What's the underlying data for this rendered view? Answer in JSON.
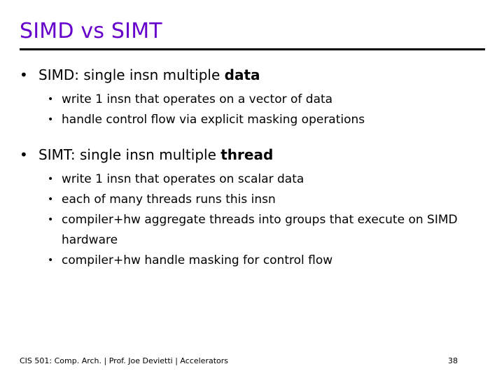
{
  "slide": {
    "title": "SIMD vs SIMT",
    "accent_color": "#6600cc",
    "rule_color": "#000000",
    "body_color": "#000000",
    "background_color": "#ffffff",
    "bullet_marker_level1": "•",
    "bullet_marker_level2": "•"
  },
  "content": {
    "sections": [
      {
        "heading_prefix": "SIMD: single insn multiple ",
        "heading_emphasis": "data",
        "subitems": [
          "write 1 insn that operates on a vector of data",
          "handle control flow via explicit masking operations"
        ]
      },
      {
        "heading_prefix": "SIMT: single insn multiple ",
        "heading_emphasis": "thread",
        "subitems": [
          "write 1 insn that operates on scalar data",
          "each of many threads runs this insn",
          "compiler+hw aggregate threads into groups that execute on SIMD hardware",
          "compiler+hw handle masking for control flow"
        ]
      }
    ]
  },
  "footer": {
    "course": "CIS 501: Comp. Arch.",
    "separator": "|",
    "instructor": "Prof. Joe Devietti",
    "topic": "Accelerators",
    "text": "CIS 501: Comp. Arch.  |  Prof. Joe Devietti  |  Accelerators",
    "page_number": "38"
  }
}
